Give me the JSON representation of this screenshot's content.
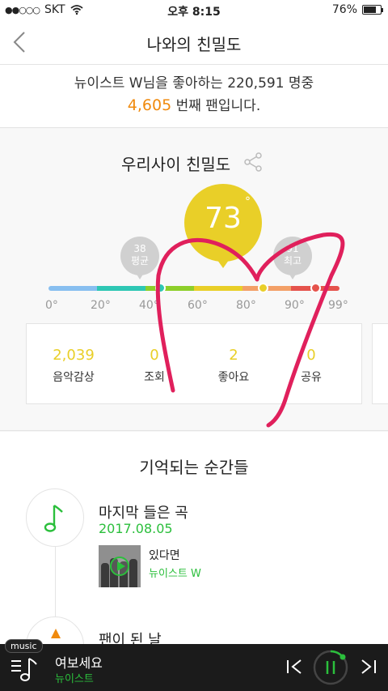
{
  "status": {
    "signal": "●●○○○",
    "carrier": "SKT",
    "time": "오후 8:15",
    "battery": "76%",
    "battery_level": 0.76
  },
  "header": {
    "title": "나와의 친밀도"
  },
  "fan": {
    "line1": "뉴이스트 W님을 좋아하는 220,591 명중",
    "rank": "4,605",
    "rank_suffix": " 번째 팬입니다."
  },
  "intimacy": {
    "title": "우리사이 친밀도",
    "value": "73",
    "degree": "°",
    "value_num": 73,
    "avg": {
      "value": "38",
      "label": "평균",
      "value_num": 38
    },
    "max": {
      "value": "91",
      "label": "최고",
      "value_num": 91
    },
    "ticks": [
      "0°",
      "20°",
      "40°",
      "60°",
      "80°",
      "90°",
      "99°"
    ],
    "colors": {
      "accent": "#e9cf28",
      "avg_marker": "#2ec7b4",
      "max_marker": "#e5534c"
    },
    "stats": [
      {
        "value": "2,039",
        "label": "음악감상"
      },
      {
        "value": "0",
        "label": "조회"
      },
      {
        "value": "2",
        "label": "좋아요"
      },
      {
        "value": "0",
        "label": "공유"
      }
    ]
  },
  "moments": {
    "title": "기억되는 순간들",
    "items": [
      {
        "title": "마지막 들은 곡",
        "date": "2017.08.05",
        "song": "있다면",
        "artist": "뉴이스트 W"
      },
      {
        "title": "팬이 된 날"
      }
    ]
  },
  "player": {
    "badge": "music",
    "title": "여보세요",
    "artist": "뉴이스트"
  },
  "brand_green": "#2bbf3c"
}
